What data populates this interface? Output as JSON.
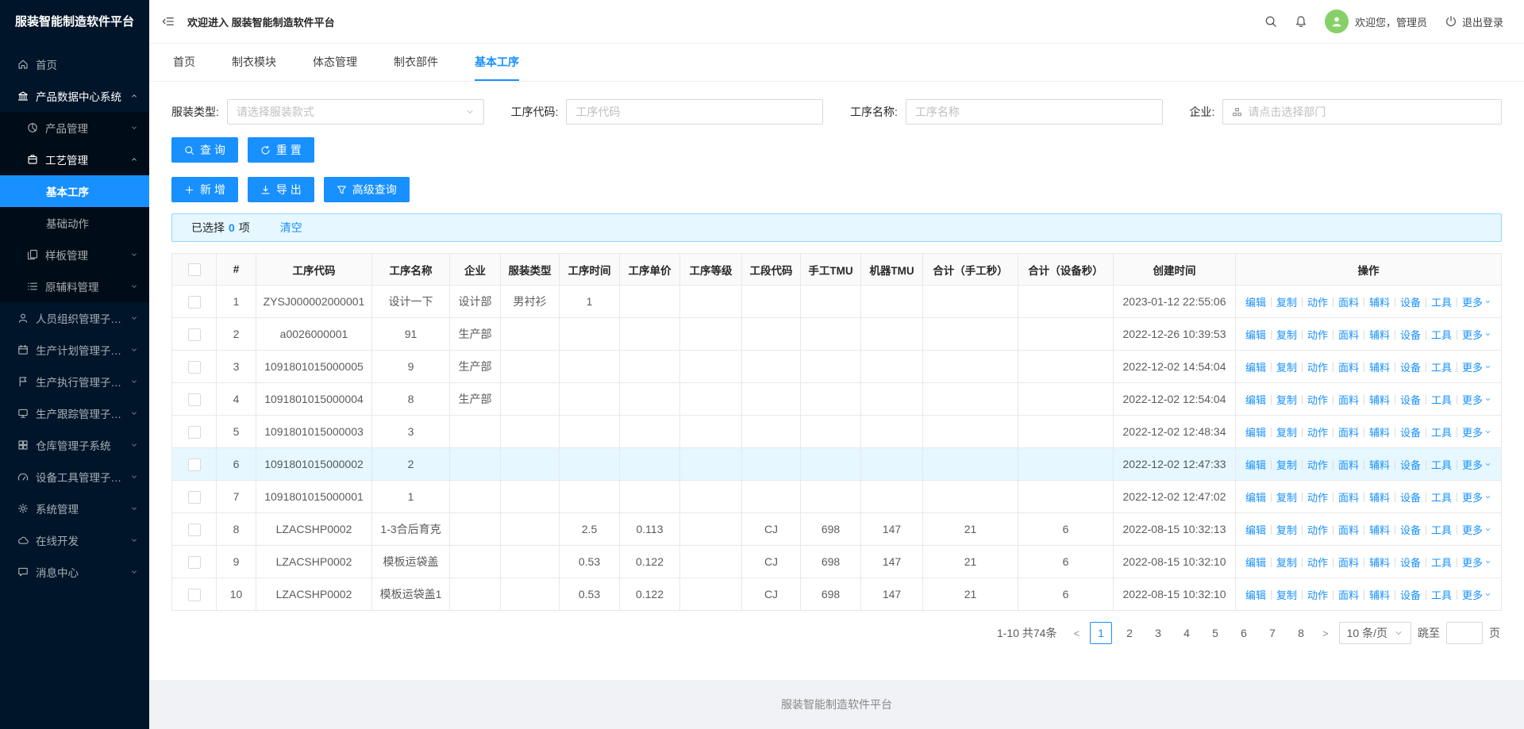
{
  "colors": {
    "accent": "#1890ff",
    "sidebar_bg": "#001529",
    "submenu_bg": "#000c17",
    "highlight_row": "#e6f7ff",
    "selection_bar_bg": "#e6f7ff",
    "avatar_bg": "#87d068"
  },
  "sidebar": {
    "title": "服装智能制造软件平台",
    "items": [
      {
        "name": "home",
        "label": "首页",
        "icon": "home",
        "level": 1
      },
      {
        "name": "product-data-center",
        "label": "产品数据中心系统",
        "icon": "bank",
        "level": 1,
        "arrow": "up",
        "emph": true
      },
      {
        "name": "product-management",
        "label": "产品管理",
        "icon": "pie",
        "level": 2,
        "arrow": "down"
      },
      {
        "name": "craft-management",
        "label": "工艺管理",
        "icon": "craft",
        "level": 2,
        "arrow": "up",
        "emph": true
      },
      {
        "name": "basic-process",
        "label": "基本工序",
        "level": 3,
        "active": true
      },
      {
        "name": "basic-action",
        "label": "基础动作",
        "level": 3
      },
      {
        "name": "template-management",
        "label": "样板管理",
        "icon": "template",
        "level": 2,
        "arrow": "down"
      },
      {
        "name": "material-management",
        "label": "原辅料管理",
        "icon": "material",
        "level": 2,
        "arrow": "down"
      },
      {
        "name": "personnel-org-subsystem",
        "label": "人员组织管理子系统",
        "icon": "team",
        "level": 1,
        "arrow": "down"
      },
      {
        "name": "production-plan-subsystem",
        "label": "生产计划管理子系统",
        "icon": "calendar",
        "level": 1,
        "arrow": "down"
      },
      {
        "name": "production-execution-subsystem",
        "label": "生产执行管理子系统",
        "icon": "flag",
        "level": 1,
        "arrow": "down"
      },
      {
        "name": "production-tracking-subsystem",
        "label": "生产跟踪管理子系统",
        "icon": "monitor",
        "level": 1,
        "arrow": "down"
      },
      {
        "name": "warehouse-subsystem",
        "label": "仓库管理子系统",
        "icon": "grid",
        "level": 1,
        "arrow": "down"
      },
      {
        "name": "equipment-tools-subsystem",
        "label": "设备工具管理子系统",
        "icon": "gauge",
        "level": 1,
        "arrow": "down"
      },
      {
        "name": "system-management",
        "label": "系统管理",
        "icon": "gear",
        "level": 1,
        "arrow": "down"
      },
      {
        "name": "online-dev",
        "label": "在线开发",
        "icon": "cloud",
        "level": 1,
        "arrow": "down"
      },
      {
        "name": "message-center",
        "label": "消息中心",
        "icon": "message",
        "level": 1,
        "arrow": "down"
      }
    ]
  },
  "header": {
    "welcome": "欢迎进入 服装智能制造软件平台",
    "user": "欢迎您，管理员",
    "logout": "退出登录"
  },
  "tabs": [
    {
      "name": "home",
      "label": "首页"
    },
    {
      "name": "garment-module",
      "label": "制衣模块"
    },
    {
      "name": "body-management",
      "label": "体态管理"
    },
    {
      "name": "garment-parts",
      "label": "制衣部件"
    },
    {
      "name": "basic-process",
      "label": "基本工序",
      "active": true
    }
  ],
  "filters": [
    {
      "name": "garment-type",
      "label": "服装类型:",
      "type": "select",
      "placeholder": "请选择服装款式"
    },
    {
      "name": "process-code",
      "label": "工序代码:",
      "type": "input",
      "placeholder": "工序代码"
    },
    {
      "name": "process-name",
      "label": "工序名称:",
      "type": "input",
      "placeholder": "工序名称"
    },
    {
      "name": "enterprise",
      "label": "企业:",
      "type": "input-icon",
      "placeholder": "请点击选择部门"
    }
  ],
  "toolbar": {
    "row1": [
      {
        "name": "search",
        "icon": "search",
        "label": "查 询"
      },
      {
        "name": "reset",
        "icon": "refresh",
        "label": "重 置"
      }
    ],
    "row2": [
      {
        "name": "add",
        "icon": "plus",
        "label": "新 增"
      },
      {
        "name": "export",
        "icon": "download",
        "label": "导 出"
      },
      {
        "name": "advanced-search",
        "icon": "funnel",
        "label": "高级查询"
      }
    ]
  },
  "selection": {
    "prefix": "已选择",
    "count": "0",
    "suffix": "项",
    "clear": "清空"
  },
  "table": {
    "columns": [
      "#",
      "工序代码",
      "工序名称",
      "企业",
      "服装类型",
      "工序时间",
      "工序单价",
      "工序等级",
      "工段代码",
      "手工TMU",
      "机器TMU",
      "合计（手工秒）",
      "合计（设备秒）",
      "创建时间",
      "操作"
    ],
    "ops": [
      {
        "name": "edit",
        "label": "编辑"
      },
      {
        "name": "copy",
        "label": "复制"
      },
      {
        "name": "action",
        "label": "动作"
      },
      {
        "name": "fabric",
        "label": "面料"
      },
      {
        "name": "accessory",
        "label": "辅料"
      },
      {
        "name": "equipment",
        "label": "设备"
      },
      {
        "name": "tool",
        "label": "工具"
      }
    ],
    "more": "更多",
    "rows": [
      {
        "cells": [
          "1",
          "ZYSJ000002000001",
          "设计一下",
          "设计部",
          "男衬衫",
          "1",
          "",
          "",
          "",
          "",
          "",
          "",
          "",
          "2023-01-12 22:55:06"
        ]
      },
      {
        "cells": [
          "2",
          "a0026000001",
          "91",
          "生产部",
          "",
          "",
          "",
          "",
          "",
          "",
          "",
          "",
          "",
          "2022-12-26 10:39:53"
        ]
      },
      {
        "cells": [
          "3",
          "1091801015000005",
          "9",
          "生产部",
          "",
          "",
          "",
          "",
          "",
          "",
          "",
          "",
          "",
          "2022-12-02 14:54:04"
        ]
      },
      {
        "cells": [
          "4",
          "1091801015000004",
          "8",
          "生产部",
          "",
          "",
          "",
          "",
          "",
          "",
          "",
          "",
          "",
          "2022-12-02 12:54:04"
        ]
      },
      {
        "cells": [
          "5",
          "1091801015000003",
          "3",
          "",
          "",
          "",
          "",
          "",
          "",
          "",
          "",
          "",
          "",
          "2022-12-02 12:48:34"
        ]
      },
      {
        "cells": [
          "6",
          "1091801015000002",
          "2",
          "",
          "",
          "",
          "",
          "",
          "",
          "",
          "",
          "",
          "",
          "2022-12-02 12:47:33"
        ],
        "highlight": true
      },
      {
        "cells": [
          "7",
          "1091801015000001",
          "1",
          "",
          "",
          "",
          "",
          "",
          "",
          "",
          "",
          "",
          "",
          "2022-12-02 12:47:02"
        ]
      },
      {
        "cells": [
          "8",
          "LZACSHP0002",
          "1-3合后育克",
          "",
          "",
          "2.5",
          "0.113",
          "",
          "CJ",
          "698",
          "147",
          "21",
          "6",
          "2022-08-15 10:32:13"
        ]
      },
      {
        "cells": [
          "9",
          "LZACSHP0002",
          "模板运袋盖",
          "",
          "",
          "0.53",
          "0.122",
          "",
          "CJ",
          "698",
          "147",
          "21",
          "6",
          "2022-08-15 10:32:10"
        ]
      },
      {
        "cells": [
          "10",
          "LZACSHP0002",
          "模板运袋盖1",
          "",
          "",
          "0.53",
          "0.122",
          "",
          "CJ",
          "698",
          "147",
          "21",
          "6",
          "2022-08-15 10:32:10"
        ]
      }
    ]
  },
  "pagination": {
    "total": "1-10 共74条",
    "pages": [
      "1",
      "2",
      "3",
      "4",
      "5",
      "6",
      "7",
      "8"
    ],
    "active": "1",
    "page_size": "10 条/页",
    "jump_label": "跳至",
    "jump_suffix": "页"
  },
  "footer": "服装智能制造软件平台"
}
